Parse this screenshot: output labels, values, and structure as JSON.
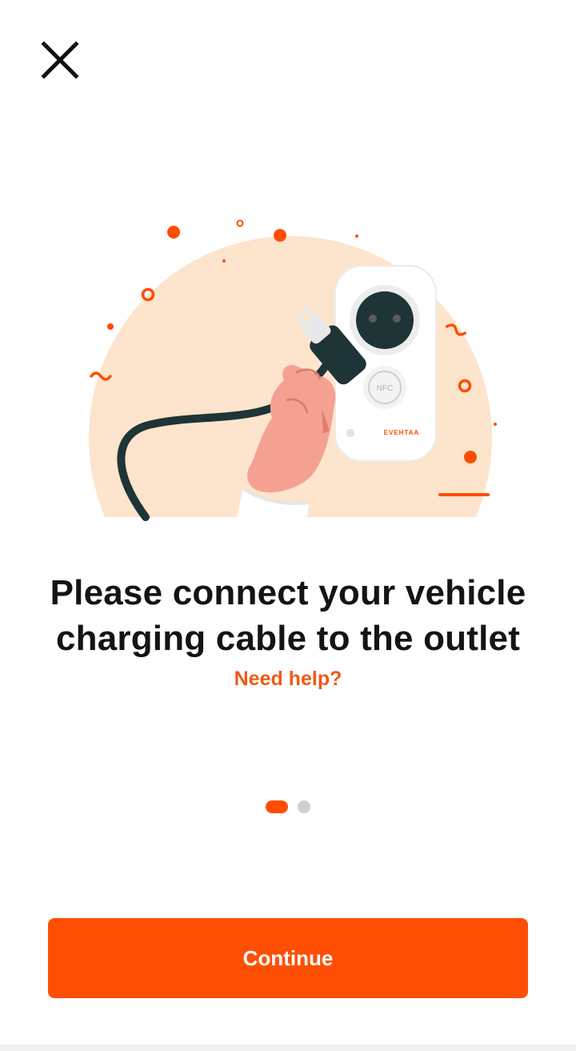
{
  "header": {
    "close_icon": "close-icon"
  },
  "illustration": {
    "brand_text": "EVEHTAA",
    "nfc_text": "NFC",
    "colors": {
      "accent": "#ff4d00",
      "background_circle": "#fde4cc",
      "cable": "#1f3436",
      "hand": "#f5a192"
    }
  },
  "content": {
    "title_line1": "Please connect your vehicle",
    "title_line2": "charging cable to the outlet",
    "help_link": "Need help?"
  },
  "pager": {
    "current": 1,
    "total": 2
  },
  "footer": {
    "continue_label": "Continue"
  },
  "theme": {
    "primary": "#ff4f05",
    "text": "#141414",
    "link": "#ee5a16"
  }
}
